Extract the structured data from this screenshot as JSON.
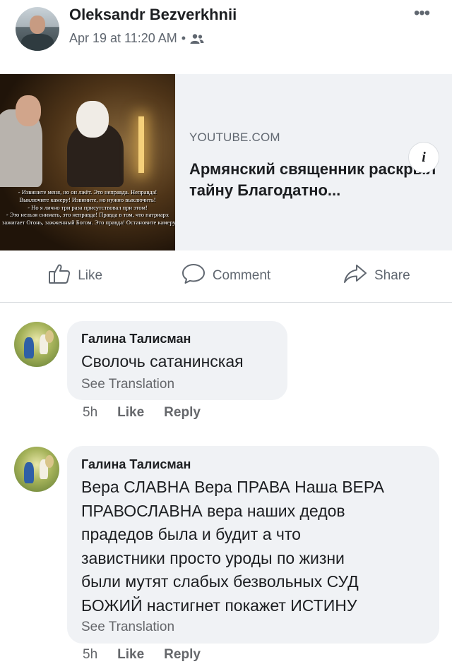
{
  "post": {
    "author": "Oleksandr Bezverkhnii",
    "timestamp": "Apr 19 at 11:20 AM",
    "separator": "•",
    "audience_icon": "friends-icon",
    "more_icon": "more-horizontal-icon",
    "more_label": "•••"
  },
  "link_preview": {
    "domain": "YOUTUBE.COM",
    "title": "Армянский священник раскрыл тайну Благодатно...",
    "info_label": "i",
    "thumbnail_caption": [
      "- Извините меня, но он лжёт. Это неправда. Неправда!",
      "Выключите камеру! Извините, но нужно выключить!",
      "- Но я лично три раза присутствовал при этом!",
      "- Это нельзя снимать, это неправда! Правда в том, что патриарх",
      "зажигает Огонь, зажженный Богом. Это правда! Остановите камеру"
    ]
  },
  "actions": {
    "like": "Like",
    "comment": "Comment",
    "share": "Share"
  },
  "comments": [
    {
      "author": "Галина Талисман",
      "text_lines": [
        "Сволочь сатанинская"
      ],
      "see_translation": "See Translation",
      "time": "5h",
      "like": "Like",
      "reply": "Reply"
    },
    {
      "author": "Галина Талисман",
      "text_lines": [
        "Вера СЛАВНА  Вера ПРАВА Наша ВЕРА",
        "ПРАВОСЛАВНА вера наших дедов",
        "прадедов была и будит  а что",
        "завистники просто уроды по жизни",
        "были мутят слабых безвольных  СУД",
        "БОЖИЙ настигнет  покажет ИСТИНУ"
      ],
      "see_translation": "See Translation",
      "time": "5h",
      "like": "Like",
      "reply": "Reply"
    }
  ],
  "colors": {
    "text_primary": "#1c1e21",
    "text_secondary": "#606770",
    "bubble": "#f0f2f5",
    "card": "#f0f2f5"
  }
}
